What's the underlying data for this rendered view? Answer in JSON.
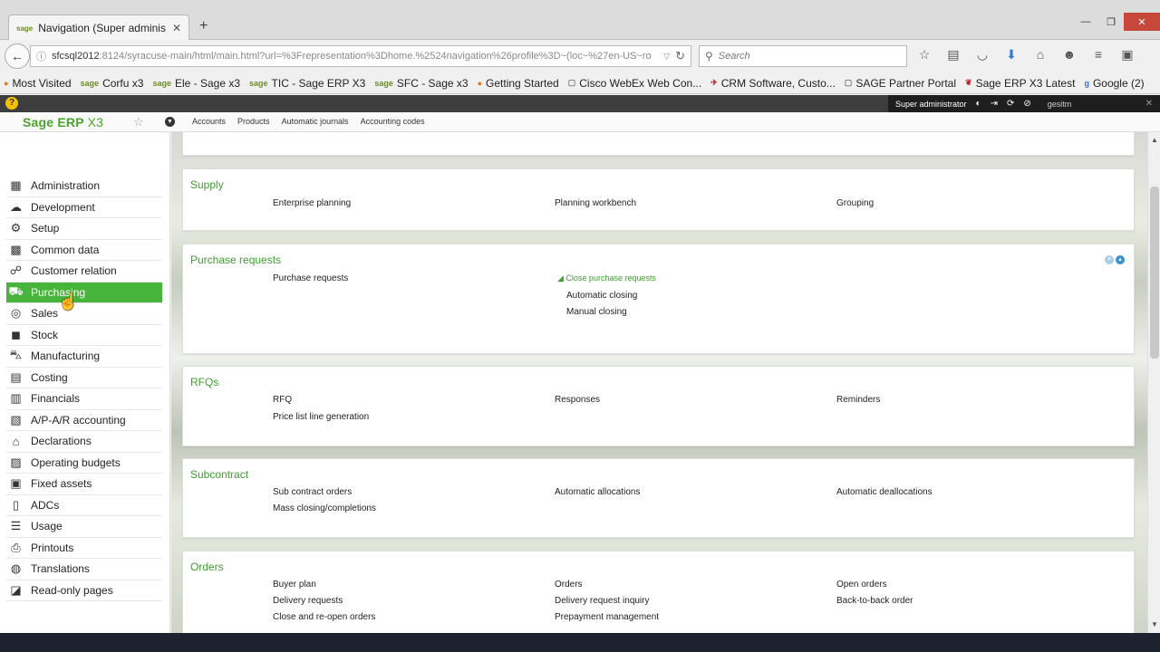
{
  "browser": {
    "tab_title": "Navigation (Super adminis...",
    "tab_favicon": "sage",
    "url": "sfcsql2012",
    "url_rest": ":8124/syracuse-main/html/main.html?url=%3Frepresentation%3Dhome.%2524navigation%26profile%3D~(loc~%27en-US~ro",
    "search_placeholder": "Search",
    "bookmarks": [
      {
        "icon": "firefox-icon",
        "label": "Most Visited"
      },
      {
        "icon": "sage",
        "label": "Corfu x3"
      },
      {
        "icon": "sage",
        "label": "Ele - Sage x3"
      },
      {
        "icon": "sage",
        "label": "TIC - Sage ERP X3"
      },
      {
        "icon": "sage",
        "label": "SFC - Sage x3"
      },
      {
        "icon": "firefox-icon",
        "label": "Getting Started"
      },
      {
        "icon": "page-icon",
        "label": "Cisco WebEx Web Con..."
      },
      {
        "icon": "crm-icon",
        "label": "CRM Software, Custo..."
      },
      {
        "icon": "page-icon",
        "label": "SAGE Partner Portal"
      },
      {
        "icon": "sage-icon",
        "label": "Sage ERP X3 Latest"
      },
      {
        "icon": "google-icon",
        "label": "Google (2)"
      }
    ]
  },
  "sage": {
    "logo_main": "Sage ERP ",
    "logo_x3": "X3",
    "user_label": "Super administrator",
    "folder": "gesitm",
    "quick_links": [
      "Accounts",
      "Products",
      "Automatic journals",
      "Accounting codes"
    ]
  },
  "sidebar": {
    "items": [
      {
        "label": "Administration",
        "icon": "briefcase-icon"
      },
      {
        "label": "Development",
        "icon": "cloud-icon"
      },
      {
        "label": "Setup",
        "icon": "gears-icon"
      },
      {
        "label": "Common data",
        "icon": "cubes-icon"
      },
      {
        "label": "Customer relation",
        "icon": "handshake-icon"
      },
      {
        "label": "Purchasing",
        "icon": "basket-icon",
        "active": true
      },
      {
        "label": "Sales",
        "icon": "coins-icon"
      },
      {
        "label": "Stock",
        "icon": "box-icon"
      },
      {
        "label": "Manufacturing",
        "icon": "truck-icon"
      },
      {
        "label": "Costing",
        "icon": "calculator-icon"
      },
      {
        "label": "Financials",
        "icon": "ledger-icon"
      },
      {
        "label": "A/P-A/R accounting",
        "icon": "document-icon"
      },
      {
        "label": "Declarations",
        "icon": "bank-icon"
      },
      {
        "label": "Operating budgets",
        "icon": "budget-icon"
      },
      {
        "label": "Fixed assets",
        "icon": "asset-icon"
      },
      {
        "label": "ADCs",
        "icon": "scanner-icon"
      },
      {
        "label": "Usage",
        "icon": "stack-icon"
      },
      {
        "label": "Printouts",
        "icon": "printer-icon"
      },
      {
        "label": "Translations",
        "icon": "globe-icon"
      },
      {
        "label": "Read-only pages",
        "icon": "book-icon"
      }
    ]
  },
  "sections": {
    "supply": {
      "title": "Supply",
      "links": [
        "Enterprise planning",
        "Planning workbench",
        "Grouping"
      ]
    },
    "purchase_requests": {
      "title": "Purchase requests",
      "links": [
        "Purchase requests"
      ],
      "group_title": "Close purchase requests",
      "group_links": [
        "Automatic closing",
        "Manual closing"
      ]
    },
    "rfqs": {
      "title": "RFQs",
      "links": [
        "RFQ",
        "Responses",
        "Reminders",
        "Price list line generation"
      ]
    },
    "subcontract": {
      "title": "Subcontract",
      "links": [
        "Sub contract orders",
        "Automatic allocations",
        "Automatic deallocations",
        "Mass closing/completions"
      ]
    },
    "orders": {
      "title": "Orders",
      "links": [
        "Buyer plan",
        "Orders",
        "Open orders",
        "Delivery requests",
        "Delivery request inquiry",
        "Back-to-back order",
        "Close and re-open orders",
        "Prepayment management"
      ]
    }
  },
  "colors": {
    "accent_green": "#47b53b",
    "section_title_green": "#3e9e2f"
  }
}
